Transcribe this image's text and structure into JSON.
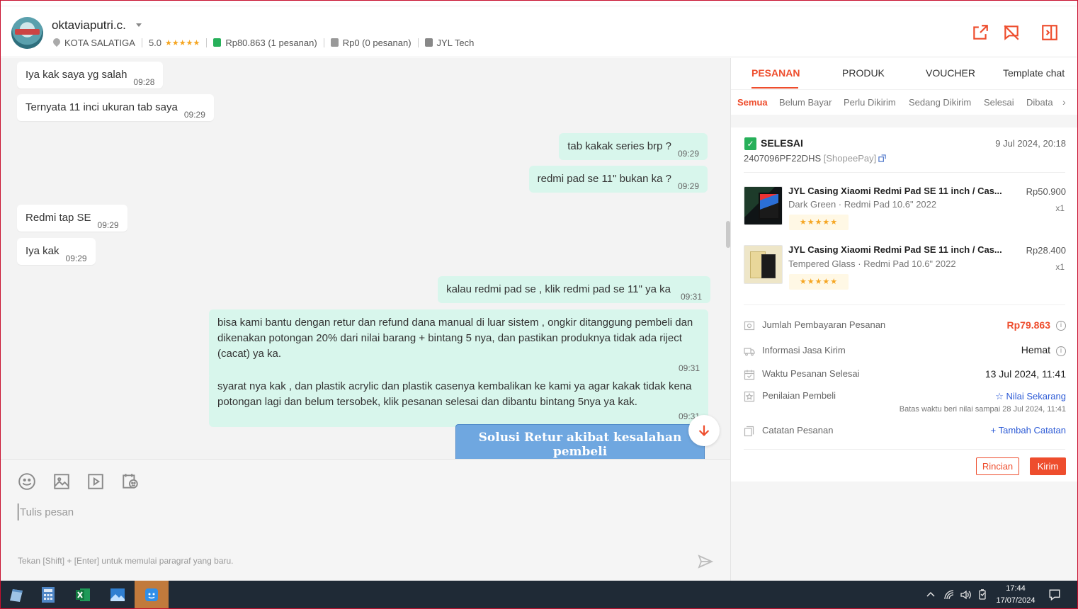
{
  "header": {
    "username": "oktaviaputri.c.",
    "location": "KOTA SALATIGA",
    "rating": "5.0",
    "stars": "★★★★★",
    "completed_orders": "Rp80.863 (1 pesanan)",
    "cancelled_orders": "Rp0 (0 pesanan)",
    "shop": "JYL Tech"
  },
  "chat": {
    "messages": [
      {
        "text": "Iya kak saya yg salah",
        "time": "09:28"
      },
      {
        "text": "Ternyata 11 inci ukuran tab saya",
        "time": "09:29"
      },
      {
        "text": "tab kakak series brp ?",
        "time": "09:29"
      },
      {
        "text": "redmi pad se 11\" bukan ka ?",
        "time": "09:29"
      },
      {
        "text": "Redmi tap SE",
        "time": "09:29"
      },
      {
        "text": "Iya kak",
        "time": "09:29"
      },
      {
        "text": "kalau redmi pad se , klik redmi pad se 11\" ya ka",
        "time": "09:31"
      },
      {
        "text": "bisa kami bantu dengan retur dan refund dana manual di luar sistem , ongkir ditanggung pembeli dan dikenakan potongan 20% dari nilai barang + bintang 5 nya, dan pastikan produknya tidak ada riject (cacat) ya ka.",
        "time": "09:31"
      },
      {
        "text": "syarat nya kak , dan plastik acrylic dan plastik casenya kembalikan ke kami ya agar kakak tidak kena potongan lagi dan belum tersobek, klik pesanan selesai dan dibantu bintang 5nya ya kak.",
        "time": "09:31"
      }
    ],
    "image_caption": "Solusi Retur akibat kesalahan pembeli"
  },
  "composer": {
    "placeholder": "Tulis pesan",
    "hint": "Tekan [Shift] + [Enter] untuk memulai paragraf yang baru."
  },
  "panel": {
    "tabs": [
      "PESANAN",
      "PRODUK",
      "VOUCHER",
      "Template chat"
    ],
    "subtabs": [
      "Semua",
      "Belum Bayar",
      "Perlu Dikirim",
      "Sedang Dikirim",
      "Selesai",
      "Dibata"
    ],
    "order": {
      "status": "SELESAI",
      "date": "9 Jul 2024, 20:18",
      "id": "2407096PF22DHS",
      "payment": "[ShopeePay]",
      "products": [
        {
          "name": "JYL Casing Xiaomi Redmi Pad SE 11 inch / Cas...",
          "variant": "Dark Green · Redmi Pad 10.6\" 2022",
          "price": "Rp50.900",
          "qty": "x1",
          "stars": "★★★★★"
        },
        {
          "name": "JYL Casing Xiaomi Redmi Pad SE 11 inch / Cas...",
          "variant": "Tempered Glass · Redmi Pad 10.6\" 2022",
          "price": "Rp28.400",
          "qty": "x1",
          "stars": "★★★★★"
        }
      ],
      "rows": {
        "total_label": "Jumlah Pembayaran Pesanan",
        "total_value": "Rp79.863",
        "shipping_label": "Informasi Jasa Kirim",
        "shipping_value": "Hemat",
        "completed_label": "Waktu Pesanan Selesai",
        "completed_value": "13 Jul 2024, 11:41",
        "review_label": "Penilaian Pembeli",
        "review_link": "☆ Nilai Sekarang",
        "review_deadline": "Batas waktu beri nilai sampai 28 Jul 2024, 11:41",
        "note_label": "Catatan Pesanan",
        "note_link": "+ Tambah Catatan"
      },
      "buttons": {
        "details": "Rincian",
        "send": "Kirim"
      }
    }
  },
  "taskbar": {
    "time": "17:44",
    "date": "17/07/2024"
  },
  "colors": {
    "accent": "#ee4d2d",
    "bubble_out": "#d8f6ec",
    "success": "#27b05a",
    "link": "#2d5bd6"
  }
}
